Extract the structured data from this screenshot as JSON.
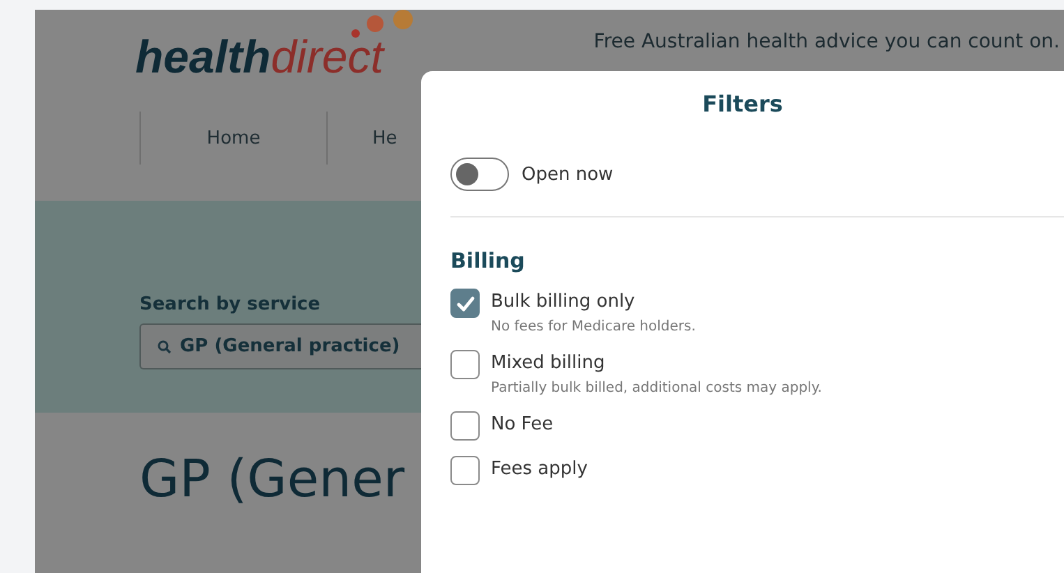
{
  "header": {
    "logo": {
      "bold": "health",
      "light": "direct"
    },
    "tagline": "Free Australian health advice you can count on."
  },
  "nav": [
    {
      "label": "Home"
    },
    {
      "label": "He"
    }
  ],
  "search": {
    "label": "Search by service",
    "value": "GP (General practice)"
  },
  "page_title": "GP (Gener",
  "filters": {
    "title": "Filters",
    "open_now": {
      "label": "Open now",
      "on": false
    },
    "billing": {
      "heading": "Billing",
      "options": [
        {
          "label": "Bulk billing only",
          "description": "No fees for Medicare holders.",
          "checked": true
        },
        {
          "label": "Mixed billing",
          "description": "Partially bulk billed, additional costs may apply.",
          "checked": false
        },
        {
          "label": "No Fee",
          "checked": false
        },
        {
          "label": "Fees apply",
          "checked": false
        }
      ]
    }
  }
}
